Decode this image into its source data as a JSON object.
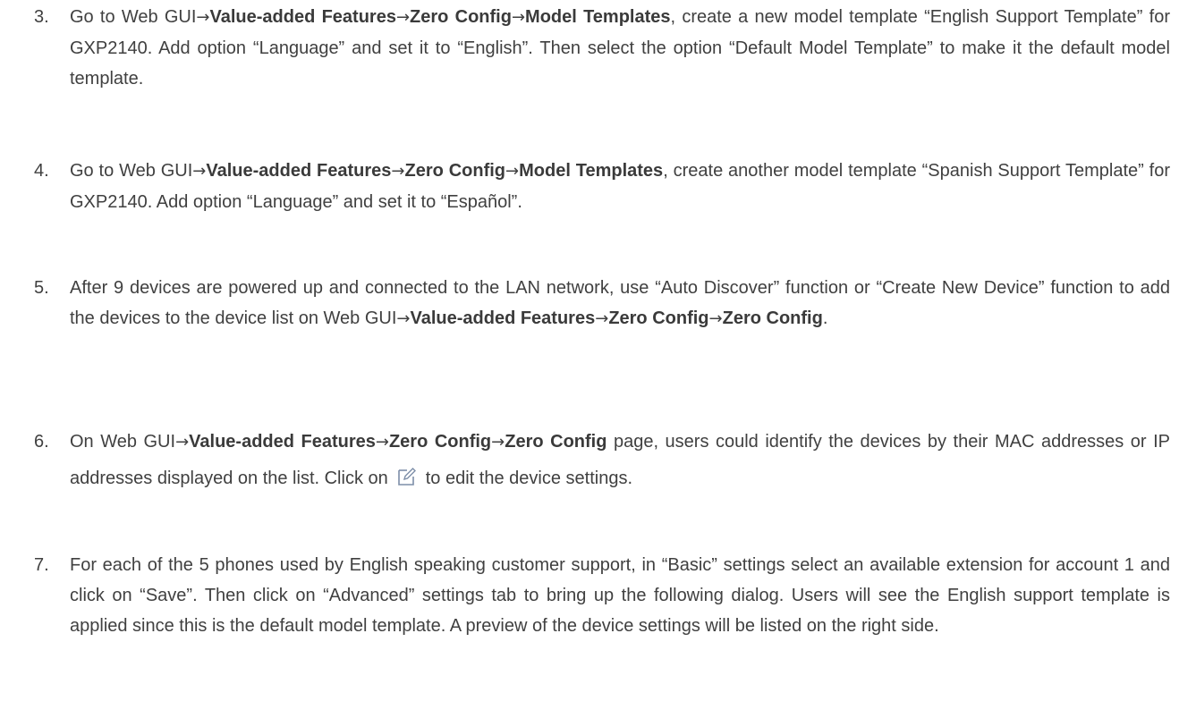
{
  "arrow": "→",
  "steps": [
    {
      "num": "3.",
      "text_a": "Go to Web GUI",
      "path1": "Value-added Features",
      "path2": "Zero Config",
      "path3": "Model Templates",
      "text_b": ", create a new model template “English Support Template” for GXP2140. Add option “Language” and set it to “English”. Then select the option “Default Model Template” to make it the default model template."
    },
    {
      "num": "4.",
      "text_a": "Go to Web GUI",
      "path1": "Value-added Features",
      "path2": "Zero Config",
      "path3": "Model Templates",
      "text_b": ", create another model template “Spanish Support Template” for GXP2140. Add option “Language” and set it to “Español”."
    },
    {
      "num": "5.",
      "text_a": "After 9 devices are powered up and connected to the LAN network, use “Auto Discover” function or “Create New Device” function to add the devices to the device list on Web GUI",
      "path1": "Value-added Features",
      "path2": "Zero Config",
      "path3": "Zero Config",
      "text_b": "."
    },
    {
      "num": "6.",
      "text_a": "On Web GUI",
      "path1": "Value-added Features",
      "path2": "Zero Config",
      "path3": "Zero Config",
      "text_b": " page, users could identify the devices by their MAC addresses or IP addresses displayed on the list. Click on",
      "text_c": "to edit the device settings.",
      "icon": "edit-icon"
    },
    {
      "num": "7.",
      "text_a": "For each of the 5 phones used by English speaking customer support, in “Basic” settings select an available extension for account 1 and click on “Save”. Then click on “Advanced” settings tab to bring up the following dialog. Users will see the English support template is applied since this is the default model template. A preview of the device settings will be listed on the right side."
    }
  ]
}
